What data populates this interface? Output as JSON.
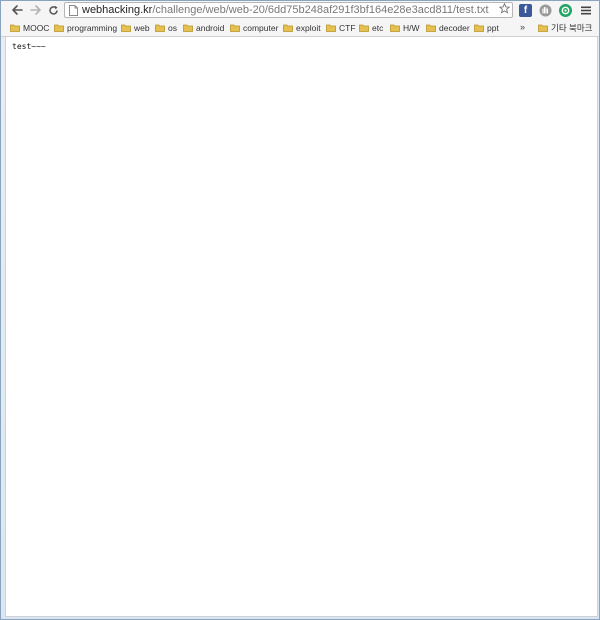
{
  "toolbar": {
    "back_icon": "back-arrow-icon",
    "forward_icon": "forward-arrow-icon",
    "reload_icon": "reload-icon",
    "url_host": "webhacking.kr",
    "url_path": "/challenge/web/web-20/6dd75b248af291f3bf164e28e3acd811/test.txt",
    "bookmark_star_icon": "star-icon",
    "menu_icon": "hamburger-menu-icon",
    "extensions": [
      {
        "name": "facebook-extension",
        "glyph": "f",
        "color": "#3b5998"
      },
      {
        "name": "gray-extension",
        "glyph": "",
        "color": "#8a8a8a"
      },
      {
        "name": "green-extension",
        "glyph": "◎",
        "color": "#22a665"
      }
    ]
  },
  "bookmarks": {
    "items": [
      "MOOC",
      "programming",
      "web",
      "os",
      "android",
      "computer",
      "exploit",
      "CTF",
      "etc",
      "H/W",
      "decoder",
      "ppt"
    ],
    "overflow": "»",
    "other_bookmarks": "기타 북마크"
  },
  "content": {
    "text": "test~~~"
  },
  "colors": {
    "folder": "#e6c14f",
    "folder_stroke": "#b8942a",
    "accent_frame": "#8aa4c0"
  }
}
